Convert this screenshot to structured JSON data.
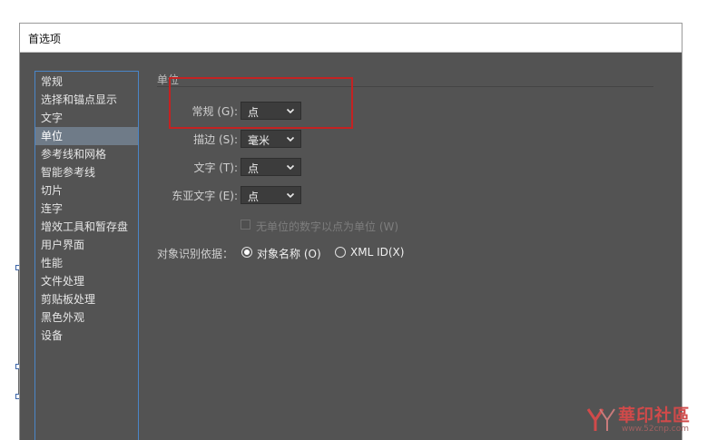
{
  "window": {
    "title": "首选项"
  },
  "nav": {
    "items": [
      {
        "label": "常规"
      },
      {
        "label": "选择和锚点显示"
      },
      {
        "label": "文字"
      },
      {
        "label": "单位",
        "selected": true
      },
      {
        "label": "参考线和网格"
      },
      {
        "label": "智能参考线"
      },
      {
        "label": "切片"
      },
      {
        "label": "连字"
      },
      {
        "label": "增效工具和暂存盘"
      },
      {
        "label": "用户界面"
      },
      {
        "label": "性能"
      },
      {
        "label": "文件处理"
      },
      {
        "label": "剪贴板处理"
      },
      {
        "label": "黑色外观"
      },
      {
        "label": "设备"
      }
    ]
  },
  "units": {
    "section_title": "单位",
    "general": {
      "label": "常规 (G):",
      "value": "点"
    },
    "stroke": {
      "label": "描边 (S):",
      "value": "毫米"
    },
    "type": {
      "label": "文字 (T):",
      "value": "点"
    },
    "asian_type": {
      "label": "东亚文字 (E):",
      "value": "点"
    },
    "numbers_without_units": {
      "label": "无单位的数字以点为单位 (W)",
      "checked": false,
      "disabled": true
    },
    "identify_objects": {
      "label": "对象识别依据：",
      "options": [
        {
          "label": "对象名称 (O)",
          "checked": true
        },
        {
          "label": "XML ID(X)",
          "checked": false
        }
      ]
    }
  },
  "watermark": {
    "title": "華印社區",
    "url": "www.52cnp.com"
  },
  "colors": {
    "panel_bg": "#535353",
    "nav_selected": "#6f7b88",
    "nav_border": "#4a86c8",
    "highlight": "#c42222",
    "watermark": "#d04a4a"
  }
}
